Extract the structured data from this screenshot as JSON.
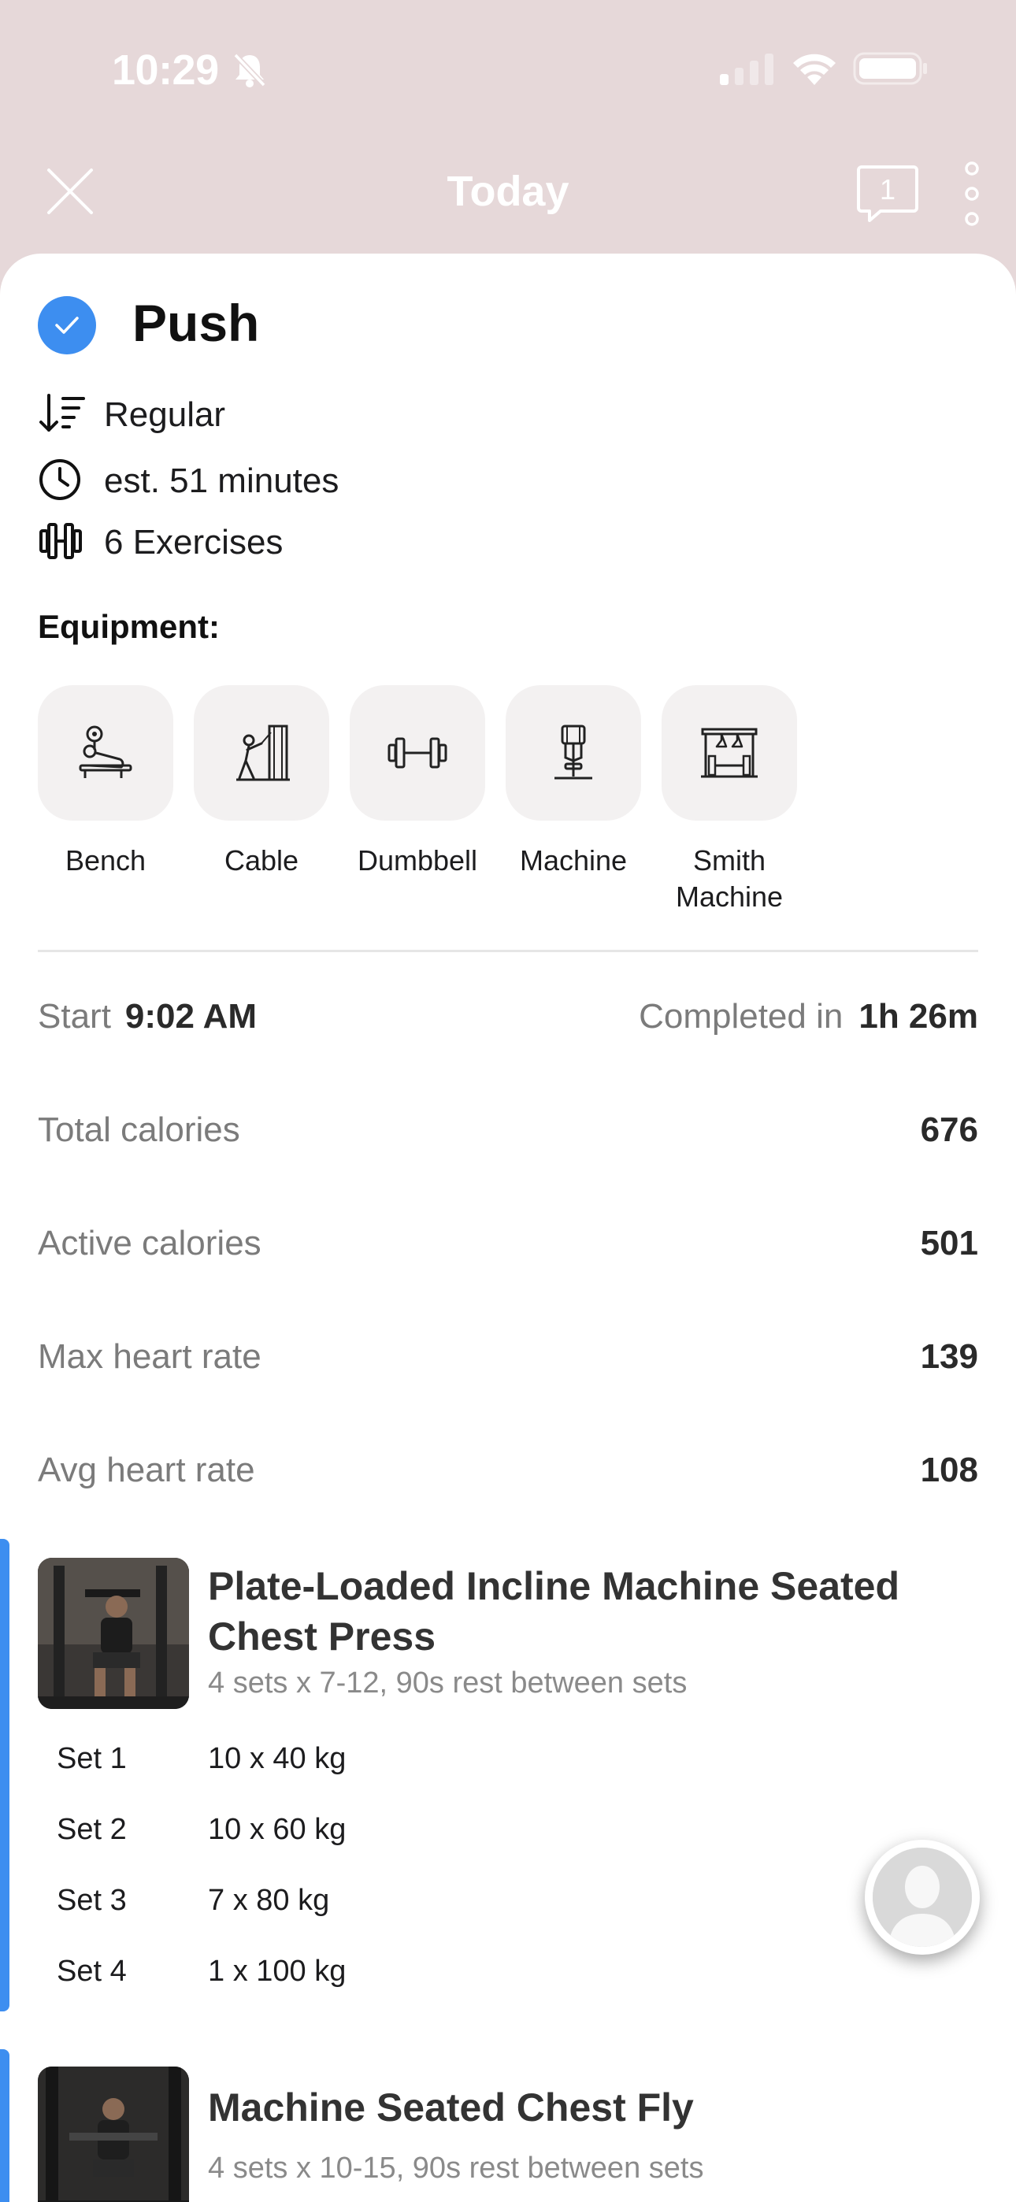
{
  "status_bar": {
    "time": "10:29",
    "icons": [
      "bell-slash-icon",
      "cellular-signal-icon",
      "wifi-icon",
      "battery-icon"
    ]
  },
  "nav": {
    "title": "Today",
    "chat_count": "1",
    "icons": [
      "close-icon",
      "chat-bubble-icon",
      "more-vertical-icon"
    ]
  },
  "workout": {
    "title": "Push",
    "completed": true,
    "order": "Regular",
    "duration": "est. 51 minutes",
    "exercise_count": "6 Exercises",
    "accent_color": "#3d8ef0"
  },
  "equipment": {
    "heading": "Equipment:",
    "items": [
      {
        "label": "Bench",
        "icon": "bench-icon"
      },
      {
        "label": "Cable",
        "icon": "cable-machine-icon"
      },
      {
        "label": "Dumbbell",
        "icon": "dumbbell-icon"
      },
      {
        "label": "Machine",
        "icon": "machine-icon"
      },
      {
        "label": "Smith Machine",
        "icon": "smith-machine-icon"
      }
    ]
  },
  "stats": {
    "start_label": "Start",
    "start_value": "9:02 AM",
    "completed_label": "Completed in",
    "completed_value": "1h 26m",
    "rows": [
      {
        "label": "Total calories",
        "value": "676"
      },
      {
        "label": "Active calories",
        "value": "501"
      },
      {
        "label": "Max heart rate",
        "value": "139"
      },
      {
        "label": "Avg heart rate",
        "value": "108"
      }
    ]
  },
  "exercises": [
    {
      "name": "Plate-Loaded Incline Machine Seated Chest Press",
      "summary": "4 sets x 7-12, 90s rest between sets",
      "sets": [
        {
          "label": "Set 1",
          "value": "10 x 40 kg"
        },
        {
          "label": "Set 2",
          "value": "10 x 60 kg"
        },
        {
          "label": "Set 3",
          "value": "7 x 80 kg"
        },
        {
          "label": "Set 4",
          "value": "1 x 100 kg"
        }
      ]
    },
    {
      "name": "Machine Seated Chest Fly",
      "summary": "4 sets x 10-15, 90s rest between sets",
      "sets": []
    }
  ]
}
